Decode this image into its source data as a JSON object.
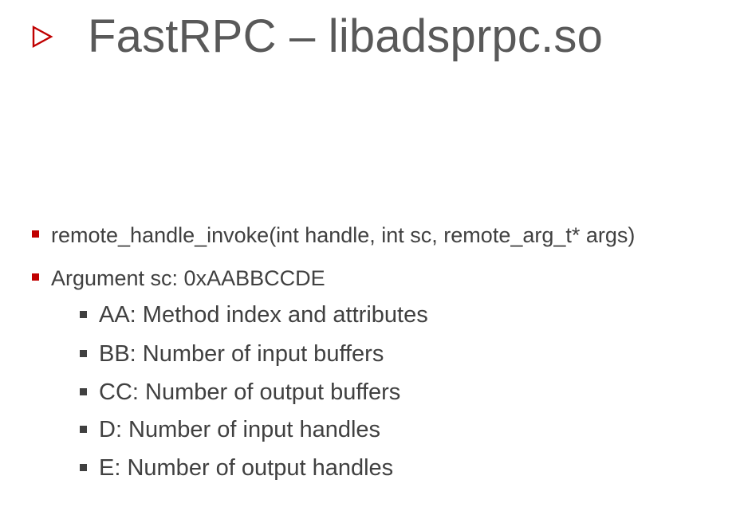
{
  "slide": {
    "title": "FastRPC – libadsprpc.so",
    "title_marker_icon": "triangle-right-outline-icon",
    "accent_color": "#c00000",
    "text_color": "#404040",
    "bullets": [
      {
        "text": "remote_handle_invoke(int handle, int sc, remote_arg_t* args)",
        "children": []
      },
      {
        "text": "Argument sc: 0xAABBCCDE",
        "children": [
          "AA: Method index and attributes",
          "BB: Number of input buffers",
          "CC: Number of output buffers",
          "D: Number of input handles",
          "E: Number of output handles"
        ]
      }
    ]
  }
}
